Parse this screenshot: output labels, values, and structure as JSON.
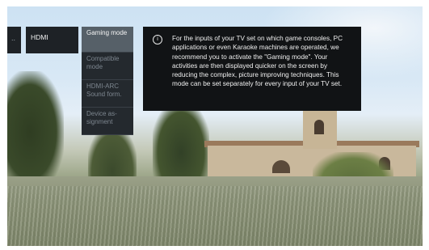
{
  "menu": {
    "back_label": "..",
    "hdmi_label": "HDMI"
  },
  "submenu": {
    "items": [
      {
        "label": "Gaming mode",
        "active": true
      },
      {
        "label": "Compatible mode",
        "active": false
      },
      {
        "label": "HDMI-ARC Sound form.",
        "active": false
      },
      {
        "label": "Device as-signment",
        "active": false
      }
    ]
  },
  "info": {
    "icon": "info-icon",
    "text": "For the inputs of your TV set on which game consoles, PC applications or even Karaoke machines are operated, we recommend you to activate the \"Gaming mode\". Your activities are then displayed quicker on the screen by reducing the complex, picture improving techniques. This mode can be set separately for every input of your TV set."
  }
}
